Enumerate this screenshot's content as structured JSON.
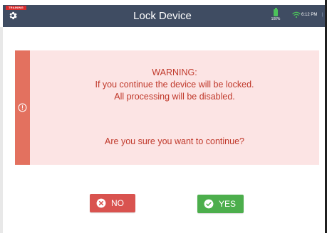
{
  "header": {
    "badge": "TRAINING",
    "title": "Lock Device",
    "battery_percent": "100%",
    "time": "6:12 PM",
    "edge_indicator": "|"
  },
  "warning": {
    "heading": "WARNING:",
    "line1": "If you continue the device will be locked.",
    "line2": "All processing will be disabled.",
    "question": "Are you sure you want to continue?"
  },
  "buttons": {
    "no_label": "NO",
    "yes_label": "YES"
  },
  "colors": {
    "header_bg": "#3f4c62",
    "badge_bg": "#d92b2b",
    "warning_bg": "#fce4e4",
    "warning_strip": "#e3715f",
    "warning_text": "#c0392b",
    "no_button": "#d9534f",
    "yes_button": "#4cae4c",
    "battery": "#4cc25a",
    "wifi": "#4cc25a"
  },
  "icons": {
    "settings": "gear-icon",
    "battery": "battery-icon",
    "wifi": "wifi-icon",
    "alert": "alert-circle-icon",
    "no": "x-circle-icon",
    "yes": "check-circle-icon"
  }
}
